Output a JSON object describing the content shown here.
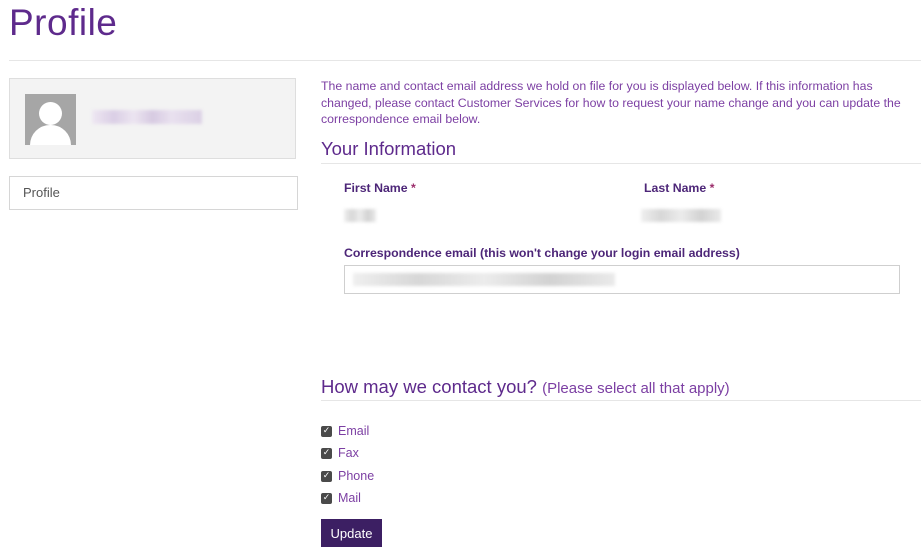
{
  "page": {
    "title": "Profile"
  },
  "sidebar": {
    "nav_items": [
      {
        "label": "Profile"
      }
    ]
  },
  "main": {
    "intro_text": "The name and contact email address we hold on file for you is displayed below. If this information has changed, please contact Customer Services for how to request your name change and you can update the correspondence email below.",
    "your_information": {
      "heading": "Your Information",
      "first_name_label": "First Name",
      "last_name_label": "Last Name",
      "required_marker": "*",
      "email_label": "Correspondence email (this won't change your login email address)"
    },
    "contact": {
      "heading": "How may we contact you?",
      "subheading": "(Please select all that apply)",
      "options": [
        {
          "label": "Email",
          "checked": true
        },
        {
          "label": "Fax",
          "checked": true
        },
        {
          "label": "Phone",
          "checked": true
        },
        {
          "label": "Mail",
          "checked": true
        }
      ],
      "checkmark": "✓"
    },
    "update_label": "Update"
  },
  "colors": {
    "accent": "#5e2a8c",
    "button_bg": "#3c1f63",
    "required": "#9b2d6b"
  }
}
